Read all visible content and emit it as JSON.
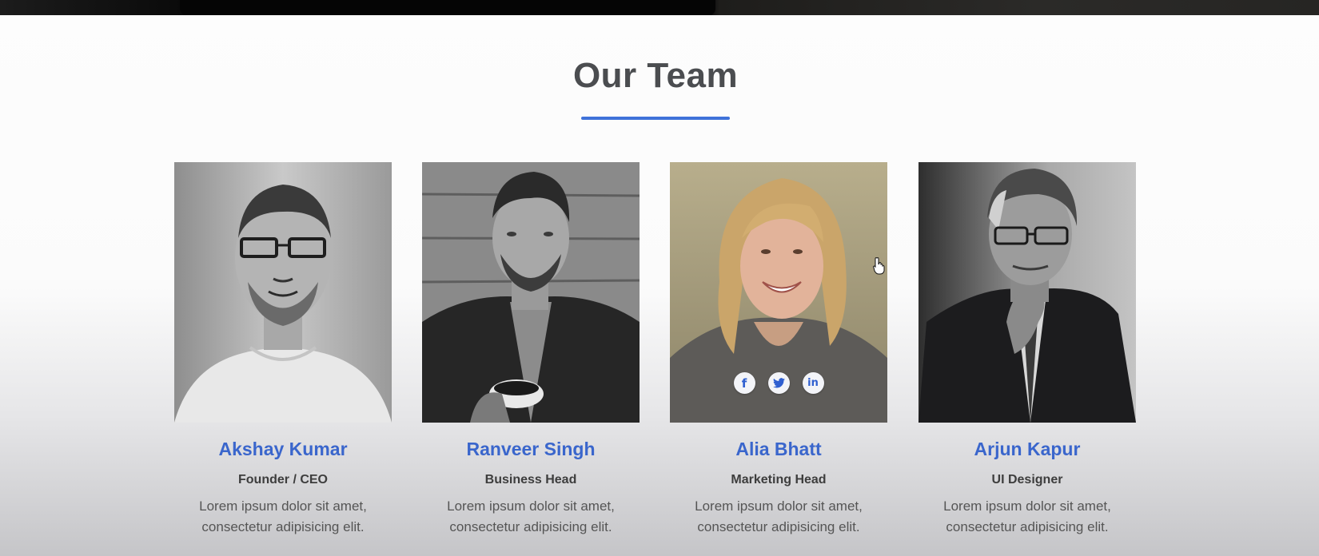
{
  "section": {
    "title": "Our Team"
  },
  "colors": {
    "accent": "#3f72d9",
    "name": "#3a66cc",
    "title": "#4b4d50"
  },
  "team": [
    {
      "name": "Akshay Kumar",
      "role": "Founder / CEO",
      "description": "Lorem ipsum dolor sit amet, consectetur adipisicing elit."
    },
    {
      "name": "Ranveer Singh",
      "role": "Business Head",
      "description": "Lorem ipsum dolor sit amet, consectetur adipisicing elit."
    },
    {
      "name": "Alia Bhatt",
      "role": "Marketing Head",
      "description": "Lorem ipsum dolor sit amet, consectetur adipisicing elit.",
      "social": [
        {
          "icon": "facebook-icon",
          "glyph": "f"
        },
        {
          "icon": "twitter-icon",
          "glyph": "🐦"
        },
        {
          "icon": "linkedin-icon",
          "glyph": "in"
        }
      ]
    },
    {
      "name": "Arjun Kapur",
      "role": "UI Designer",
      "description": "Lorem ipsum dolor sit amet, consectetur adipisicing elit."
    }
  ]
}
